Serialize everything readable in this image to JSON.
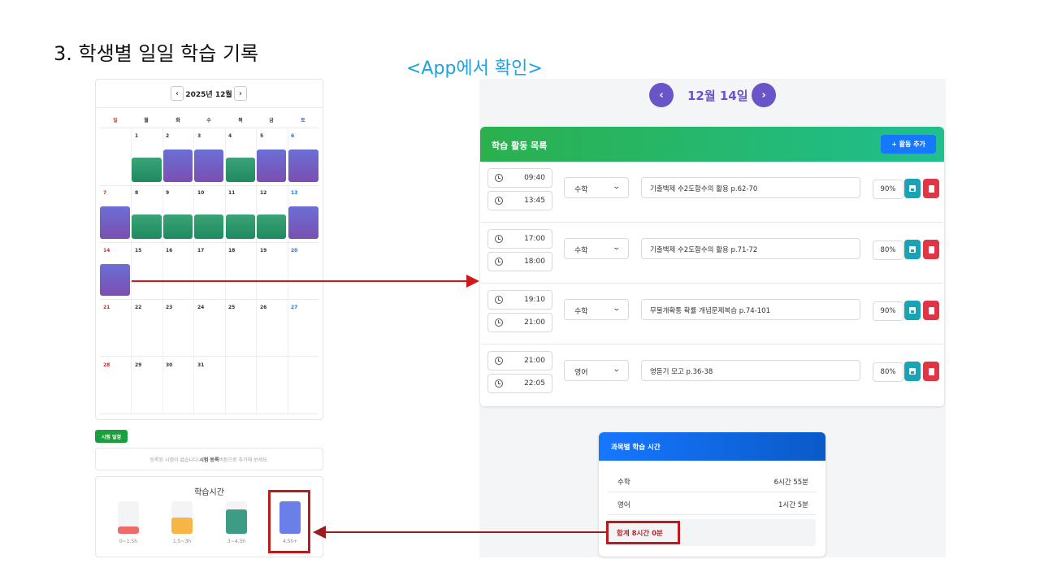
{
  "slide_title": "3. 학생별 일일 학습 기록",
  "app_note": "<App에서 확인>",
  "calendar": {
    "month_label": "2025년 12월",
    "prev": "‹",
    "next": "›",
    "weekdays": [
      "일",
      "월",
      "화",
      "수",
      "목",
      "금",
      "토"
    ],
    "days": [
      "1",
      "2",
      "3",
      "4",
      "5",
      "6",
      "7",
      "8",
      "9",
      "10",
      "11",
      "12",
      "13",
      "14",
      "15",
      "16",
      "17",
      "18",
      "19",
      "20",
      "21",
      "22",
      "23",
      "24",
      "25",
      "26",
      "27",
      "28",
      "29",
      "30",
      "31"
    ],
    "colors": {
      "green": "#2a9a6a",
      "purple": "#7052b8",
      "sunday": "#d32f2f",
      "saturday": "#1976d2"
    }
  },
  "exam": {
    "badge": "시험 일정",
    "empty_pre": "등록된 시험이 없습니다. ",
    "empty_bold": "시험 등록",
    "empty_post": " 버튼으로 추가해 보세요."
  },
  "study_time": {
    "title": "학습시간",
    "bars": [
      {
        "label": "0~1.5h",
        "color": "#ef6b6b"
      },
      {
        "label": "1.5~3h",
        "color": "#f7b545"
      },
      {
        "label": "3~4.5h",
        "color": "#3e9b84"
      },
      {
        "label": "4.5h+",
        "color": "#6b7fe8"
      }
    ]
  },
  "app": {
    "prev": "‹",
    "next": "›",
    "date": "12월 14일",
    "list_title": "학습 활동 목록",
    "add_button": "+ 활동 추가",
    "activities": [
      {
        "start": "09:40",
        "end": "13:45",
        "subject": "수학",
        "desc": "기출백제 수2도함수의 활용 p.62-70",
        "pct": "90%"
      },
      {
        "start": "17:00",
        "end": "18:00",
        "subject": "수학",
        "desc": "기출백제 수2도함수의 활용 p.71-72",
        "pct": "80%"
      },
      {
        "start": "19:10",
        "end": "21:00",
        "subject": "수학",
        "desc": "무불개확통 확률 개념문제복습 p.74-101",
        "pct": "90%"
      },
      {
        "start": "21:00",
        "end": "22:05",
        "subject": "영어",
        "desc": "영듣기 모고 p.36-38",
        "pct": "80%"
      }
    ],
    "summary": {
      "title": "과목별 학습 시간",
      "rows": [
        {
          "subject": "수학",
          "time": "6시간 55분"
        },
        {
          "subject": "영어",
          "time": "1시간 5분"
        }
      ],
      "total": "합계 8시간 0분"
    }
  }
}
